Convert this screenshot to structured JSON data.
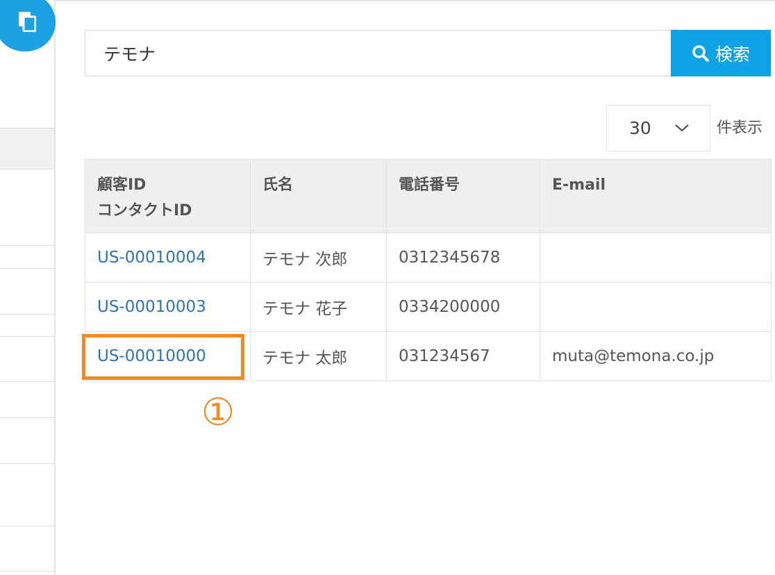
{
  "sidebar": {
    "icon": "documents-icon"
  },
  "search": {
    "value": "テモナ",
    "button_label": "検索",
    "button_icon": "search-icon"
  },
  "pagination": {
    "per_page_value": "30",
    "per_page_suffix": "件表示"
  },
  "table": {
    "headers": [
      {
        "line1": "顧客ID",
        "line2": "コンタクトID"
      },
      {
        "line1": "氏名",
        "line2": ""
      },
      {
        "line1": "電話番号",
        "line2": ""
      },
      {
        "line1": "E-mail",
        "line2": ""
      }
    ],
    "rows": [
      {
        "customer_id": "US-00010004",
        "name": "テモナ 次郎",
        "phone": "0312345678",
        "email": ""
      },
      {
        "customer_id": "US-00010003",
        "name": "テモナ 花子",
        "phone": "0334200000",
        "email": ""
      },
      {
        "customer_id": "US-00010000",
        "name": "テモナ 太郎",
        "phone": "031234567",
        "email": "muta@temona.co.jp"
      }
    ]
  },
  "annotation": {
    "step_number": "①",
    "color": "#f08a24"
  },
  "colors": {
    "accent": "#0fa3e6",
    "link": "#2e73b3"
  }
}
